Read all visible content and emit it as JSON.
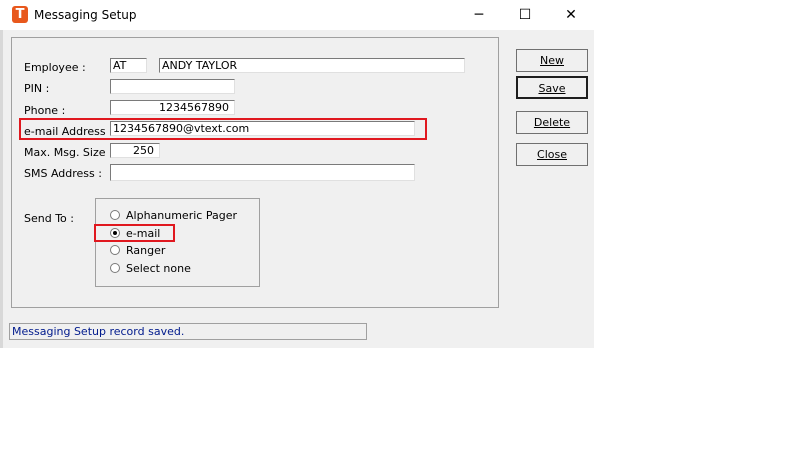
{
  "window": {
    "title": "Messaging Setup",
    "icon_letter": "T",
    "minimize": "─",
    "maximize": "☐",
    "close": "✕"
  },
  "form": {
    "employee_label": "Employee :",
    "employee_code": "AT",
    "employee_name": "ANDY TAYLOR",
    "pin_label": "PIN :",
    "pin_value": "",
    "phone_label": "Phone :",
    "phone_value": "1234567890",
    "email_label": "e-mail Address :",
    "email_value": "1234567890@vtext.com",
    "max_msg_label": "Max. Msg. Size :",
    "max_msg_value": "250",
    "sms_label": "SMS Address :",
    "sms_value": "",
    "send_to_label": "Send To :",
    "send_to_options": [
      {
        "label": "Alphanumeric Pager",
        "selected": false
      },
      {
        "label": "e-mail",
        "selected": true
      },
      {
        "label": "Ranger",
        "selected": false
      },
      {
        "label": "Select none",
        "selected": false
      }
    ]
  },
  "buttons": {
    "new": "New",
    "save": "Save",
    "delete": "Delete",
    "close": "Close"
  },
  "status": "Messaging Setup record saved.",
  "colors": {
    "highlight": "#e0181f",
    "status_text": "#001a8c",
    "app_icon": "#e8581c"
  }
}
